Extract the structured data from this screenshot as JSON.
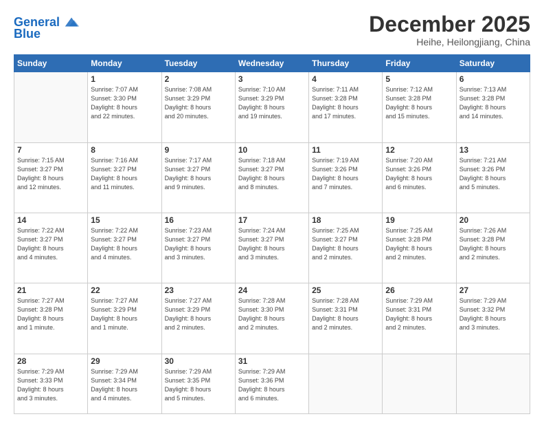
{
  "header": {
    "logo_general": "General",
    "logo_blue": "Blue",
    "month_title": "December 2025",
    "subtitle": "Heihe, Heilongjiang, China"
  },
  "days_of_week": [
    "Sunday",
    "Monday",
    "Tuesday",
    "Wednesday",
    "Thursday",
    "Friday",
    "Saturday"
  ],
  "weeks": [
    [
      {
        "num": "",
        "info": ""
      },
      {
        "num": "1",
        "info": "Sunrise: 7:07 AM\nSunset: 3:30 PM\nDaylight: 8 hours\nand 22 minutes."
      },
      {
        "num": "2",
        "info": "Sunrise: 7:08 AM\nSunset: 3:29 PM\nDaylight: 8 hours\nand 20 minutes."
      },
      {
        "num": "3",
        "info": "Sunrise: 7:10 AM\nSunset: 3:29 PM\nDaylight: 8 hours\nand 19 minutes."
      },
      {
        "num": "4",
        "info": "Sunrise: 7:11 AM\nSunset: 3:28 PM\nDaylight: 8 hours\nand 17 minutes."
      },
      {
        "num": "5",
        "info": "Sunrise: 7:12 AM\nSunset: 3:28 PM\nDaylight: 8 hours\nand 15 minutes."
      },
      {
        "num": "6",
        "info": "Sunrise: 7:13 AM\nSunset: 3:28 PM\nDaylight: 8 hours\nand 14 minutes."
      }
    ],
    [
      {
        "num": "7",
        "info": "Sunrise: 7:15 AM\nSunset: 3:27 PM\nDaylight: 8 hours\nand 12 minutes."
      },
      {
        "num": "8",
        "info": "Sunrise: 7:16 AM\nSunset: 3:27 PM\nDaylight: 8 hours\nand 11 minutes."
      },
      {
        "num": "9",
        "info": "Sunrise: 7:17 AM\nSunset: 3:27 PM\nDaylight: 8 hours\nand 9 minutes."
      },
      {
        "num": "10",
        "info": "Sunrise: 7:18 AM\nSunset: 3:27 PM\nDaylight: 8 hours\nand 8 minutes."
      },
      {
        "num": "11",
        "info": "Sunrise: 7:19 AM\nSunset: 3:26 PM\nDaylight: 8 hours\nand 7 minutes."
      },
      {
        "num": "12",
        "info": "Sunrise: 7:20 AM\nSunset: 3:26 PM\nDaylight: 8 hours\nand 6 minutes."
      },
      {
        "num": "13",
        "info": "Sunrise: 7:21 AM\nSunset: 3:26 PM\nDaylight: 8 hours\nand 5 minutes."
      }
    ],
    [
      {
        "num": "14",
        "info": "Sunrise: 7:22 AM\nSunset: 3:27 PM\nDaylight: 8 hours\nand 4 minutes."
      },
      {
        "num": "15",
        "info": "Sunrise: 7:22 AM\nSunset: 3:27 PM\nDaylight: 8 hours\nand 4 minutes."
      },
      {
        "num": "16",
        "info": "Sunrise: 7:23 AM\nSunset: 3:27 PM\nDaylight: 8 hours\nand 3 minutes."
      },
      {
        "num": "17",
        "info": "Sunrise: 7:24 AM\nSunset: 3:27 PM\nDaylight: 8 hours\nand 3 minutes."
      },
      {
        "num": "18",
        "info": "Sunrise: 7:25 AM\nSunset: 3:27 PM\nDaylight: 8 hours\nand 2 minutes."
      },
      {
        "num": "19",
        "info": "Sunrise: 7:25 AM\nSunset: 3:28 PM\nDaylight: 8 hours\nand 2 minutes."
      },
      {
        "num": "20",
        "info": "Sunrise: 7:26 AM\nSunset: 3:28 PM\nDaylight: 8 hours\nand 2 minutes."
      }
    ],
    [
      {
        "num": "21",
        "info": "Sunrise: 7:27 AM\nSunset: 3:28 PM\nDaylight: 8 hours\nand 1 minute."
      },
      {
        "num": "22",
        "info": "Sunrise: 7:27 AM\nSunset: 3:29 PM\nDaylight: 8 hours\nand 1 minute."
      },
      {
        "num": "23",
        "info": "Sunrise: 7:27 AM\nSunset: 3:29 PM\nDaylight: 8 hours\nand 2 minutes."
      },
      {
        "num": "24",
        "info": "Sunrise: 7:28 AM\nSunset: 3:30 PM\nDaylight: 8 hours\nand 2 minutes."
      },
      {
        "num": "25",
        "info": "Sunrise: 7:28 AM\nSunset: 3:31 PM\nDaylight: 8 hours\nand 2 minutes."
      },
      {
        "num": "26",
        "info": "Sunrise: 7:29 AM\nSunset: 3:31 PM\nDaylight: 8 hours\nand 2 minutes."
      },
      {
        "num": "27",
        "info": "Sunrise: 7:29 AM\nSunset: 3:32 PM\nDaylight: 8 hours\nand 3 minutes."
      }
    ],
    [
      {
        "num": "28",
        "info": "Sunrise: 7:29 AM\nSunset: 3:33 PM\nDaylight: 8 hours\nand 3 minutes."
      },
      {
        "num": "29",
        "info": "Sunrise: 7:29 AM\nSunset: 3:34 PM\nDaylight: 8 hours\nand 4 minutes."
      },
      {
        "num": "30",
        "info": "Sunrise: 7:29 AM\nSunset: 3:35 PM\nDaylight: 8 hours\nand 5 minutes."
      },
      {
        "num": "31",
        "info": "Sunrise: 7:29 AM\nSunset: 3:36 PM\nDaylight: 8 hours\nand 6 minutes."
      },
      {
        "num": "",
        "info": ""
      },
      {
        "num": "",
        "info": ""
      },
      {
        "num": "",
        "info": ""
      }
    ]
  ]
}
